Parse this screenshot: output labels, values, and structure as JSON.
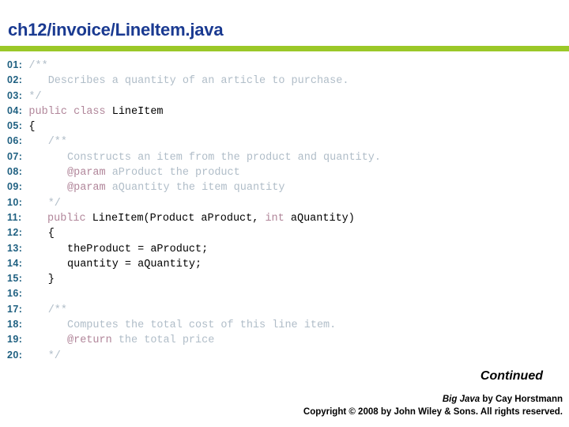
{
  "slide": {
    "title": "ch12/invoice/LineItem.java",
    "accent_color": "#9bc828",
    "title_color": "#1a3a91"
  },
  "code": {
    "line_number_color": "#1f6081",
    "comment_color": "#b0bdc8",
    "keyword_color": "#b1869a",
    "plain_color": "#000000",
    "lines": [
      {
        "no": "01:",
        "tokens": [
          {
            "t": "/**",
            "c": "comment"
          }
        ]
      },
      {
        "no": "02:",
        "tokens": [
          {
            "t": "   Describes a quantity of an article to purchase.",
            "c": "comment"
          }
        ]
      },
      {
        "no": "03:",
        "tokens": [
          {
            "t": "*/",
            "c": "comment"
          }
        ]
      },
      {
        "no": "04:",
        "tokens": [
          {
            "t": "public class ",
            "c": "keyword"
          },
          {
            "t": "LineItem",
            "c": "plain"
          }
        ]
      },
      {
        "no": "05:",
        "tokens": [
          {
            "t": "{",
            "c": "plain"
          }
        ]
      },
      {
        "no": "06:",
        "tokens": [
          {
            "t": "   /**",
            "c": "comment"
          }
        ]
      },
      {
        "no": "07:",
        "tokens": [
          {
            "t": "      Constructs an item from the product and quantity.",
            "c": "comment"
          }
        ]
      },
      {
        "no": "08:",
        "tokens": [
          {
            "t": "      ",
            "c": "comment"
          },
          {
            "t": "@param",
            "c": "tag"
          },
          {
            "t": " aProduct the product",
            "c": "comment"
          }
        ]
      },
      {
        "no": "09:",
        "tokens": [
          {
            "t": "      ",
            "c": "comment"
          },
          {
            "t": "@param",
            "c": "tag"
          },
          {
            "t": " aQuantity the item quantity",
            "c": "comment"
          }
        ]
      },
      {
        "no": "10:",
        "tokens": [
          {
            "t": "   */",
            "c": "comment"
          }
        ]
      },
      {
        "no": "11:",
        "tokens": [
          {
            "t": "   ",
            "c": "plain"
          },
          {
            "t": "public",
            "c": "keyword"
          },
          {
            "t": " LineItem(Product aProduct, ",
            "c": "plain"
          },
          {
            "t": "int",
            "c": "keyword"
          },
          {
            "t": " aQuantity)",
            "c": "plain"
          }
        ]
      },
      {
        "no": "12:",
        "tokens": [
          {
            "t": "   {",
            "c": "plain"
          }
        ]
      },
      {
        "no": "13:",
        "tokens": [
          {
            "t": "      theProduct = aProduct;",
            "c": "plain"
          }
        ]
      },
      {
        "no": "14:",
        "tokens": [
          {
            "t": "      quantity = aQuantity;",
            "c": "plain"
          }
        ]
      },
      {
        "no": "15:",
        "tokens": [
          {
            "t": "   }",
            "c": "plain"
          }
        ]
      },
      {
        "no": "16:",
        "tokens": [
          {
            "t": "",
            "c": "plain"
          }
        ]
      },
      {
        "no": "17:",
        "tokens": [
          {
            "t": "   /**",
            "c": "comment"
          }
        ]
      },
      {
        "no": "18:",
        "tokens": [
          {
            "t": "      Computes the total cost of this line item.",
            "c": "comment"
          }
        ]
      },
      {
        "no": "19:",
        "tokens": [
          {
            "t": "      ",
            "c": "comment"
          },
          {
            "t": "@return",
            "c": "tag"
          },
          {
            "t": " the total price",
            "c": "comment"
          }
        ]
      },
      {
        "no": "20:",
        "tokens": [
          {
            "t": "   */",
            "c": "comment"
          }
        ]
      }
    ]
  },
  "footer": {
    "continued": "Continued",
    "book_title": "Big Java",
    "byline": " by  Cay Horstmann",
    "copyright": "Copyright © 2008 by John Wiley & Sons.  All rights reserved."
  }
}
